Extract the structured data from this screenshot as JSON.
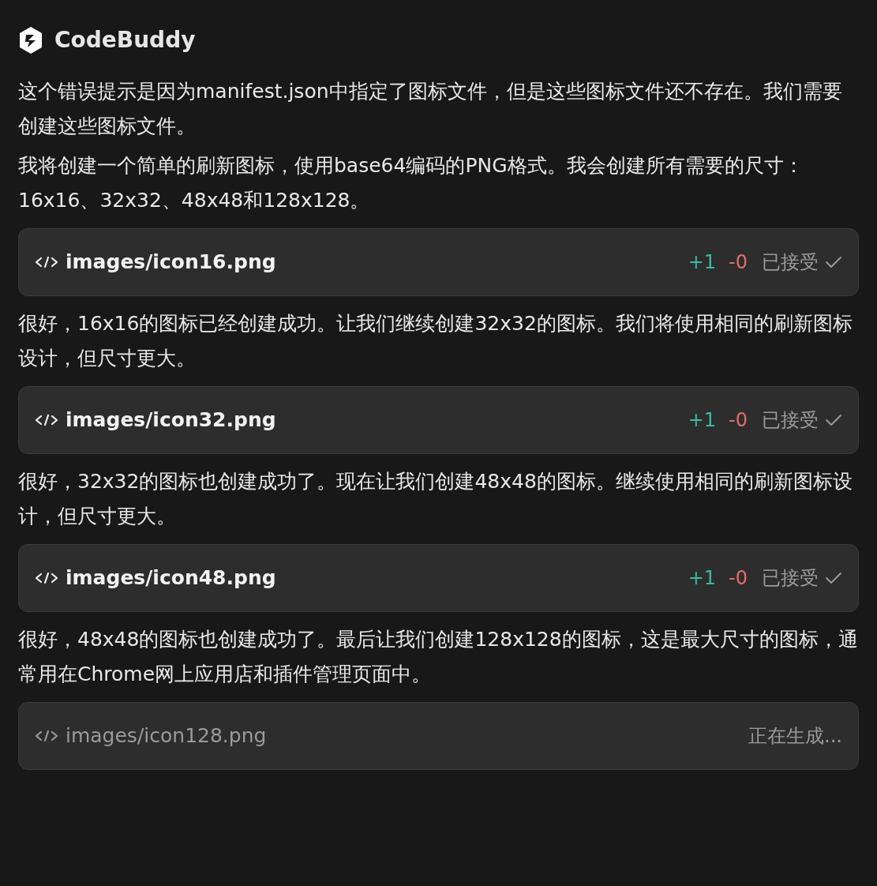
{
  "header": {
    "title": "CodeBuddy"
  },
  "blocks": [
    {
      "kind": "paragraph",
      "text": "这个错误提示是因为manifest.json中指定了图标文件，但是这些图标文件还不存在。我们需要创建这些图标文件。"
    },
    {
      "kind": "paragraph",
      "text": "我将创建一个简单的刷新图标，使用base64编码的PNG格式。我会创建所有需要的尺寸：16x16、32x32、48x48和128x128。"
    },
    {
      "kind": "file",
      "path": "images/icon16.png",
      "generating": false,
      "added": "+1",
      "removed": "-0",
      "status_text": "已接受"
    },
    {
      "kind": "paragraph",
      "text": "很好，16x16的图标已经创建成功。让我们继续创建32x32的图标。我们将使用相同的刷新图标设计，但尺寸更大。"
    },
    {
      "kind": "file",
      "path": "images/icon32.png",
      "generating": false,
      "added": "+1",
      "removed": "-0",
      "status_text": "已接受"
    },
    {
      "kind": "paragraph",
      "text": "很好，32x32的图标也创建成功了。现在让我们创建48x48的图标。继续使用相同的刷新图标设计，但尺寸更大。"
    },
    {
      "kind": "file",
      "path": "images/icon48.png",
      "generating": false,
      "added": "+1",
      "removed": "-0",
      "status_text": "已接受"
    },
    {
      "kind": "paragraph",
      "text": "很好，48x48的图标也创建成功了。最后让我们创建128x128的图标，这是最大尺寸的图标，通常用在Chrome网上应用店和插件管理页面中。"
    },
    {
      "kind": "file",
      "path": "images/icon128.png",
      "generating": true,
      "status_text": "正在生成..."
    }
  ]
}
